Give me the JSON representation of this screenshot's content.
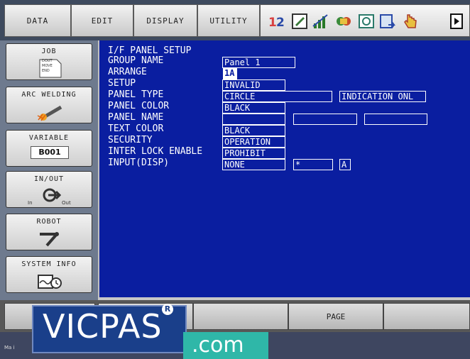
{
  "menu": {
    "tabs": [
      "DATA",
      "EDIT",
      "DISPLAY",
      "UTILITY"
    ],
    "status_icons": [
      "tool-numbers-icon",
      "edit-mode-icon",
      "signal-bars-icon",
      "teach-mode-icon",
      "play-mode-icon",
      "cycle-icon",
      "hand-servo-icon",
      "next-page-icon"
    ]
  },
  "sidebar": {
    "buttons": [
      {
        "label": "JOB",
        "icon": "job-document-icon",
        "icon_text": [
          "DOUT",
          "MOVE",
          "END"
        ]
      },
      {
        "label": "ARC WELDING",
        "icon": "welding-torch-icon"
      },
      {
        "label": "VARIABLE",
        "icon": "variable-icon",
        "icon_text": "B001"
      },
      {
        "label": "IN/OUT",
        "icon": "in-out-icon",
        "in_text": "In",
        "out_text": "Out"
      },
      {
        "label": "ROBOT",
        "icon": "robot-arm-icon"
      },
      {
        "label": "SYSTEM INFO",
        "icon": "system-info-icon"
      }
    ]
  },
  "panel": {
    "title": "I/F PANEL SETUP",
    "group_name_label": "GROUP NAME",
    "group_name_value": "Panel 1",
    "arrange_label": "ARRANGE",
    "arrange_value": "1A",
    "setup_label": "SETUP",
    "setup_value": "INVALID",
    "panel_type_label": "PANEL TYPE",
    "panel_type_value": "CIRCLE",
    "panel_type_extra": "INDICATION ONL",
    "panel_color_label": "PANEL COLOR",
    "panel_color_value": "BLACK",
    "panel_name_label": "PANEL NAME",
    "panel_name_values": [
      "",
      "",
      ""
    ],
    "text_color_label": "TEXT COLOR",
    "text_color_value": "BLACK",
    "security_label": "SECURITY",
    "security_value": "OPERATION",
    "interlock_label": "INTER LOCK ENABLE",
    "interlock_value": "PROHIBIT",
    "input_label": "INPUT(DISP)",
    "input_value": "NONE",
    "input_extra1": "*",
    "input_extra2": "A"
  },
  "bottom": {
    "page_label": "PAGE",
    "status_text": "Ma i"
  },
  "watermark": {
    "brand": "VICPAS",
    "reg": "R",
    "suffix": ".com"
  },
  "colors": {
    "screen_bg": "#0a1ea0",
    "text": "#ffffff",
    "watermark_blue": "#1a3f8a",
    "watermark_teal": "#2fb7a8"
  }
}
